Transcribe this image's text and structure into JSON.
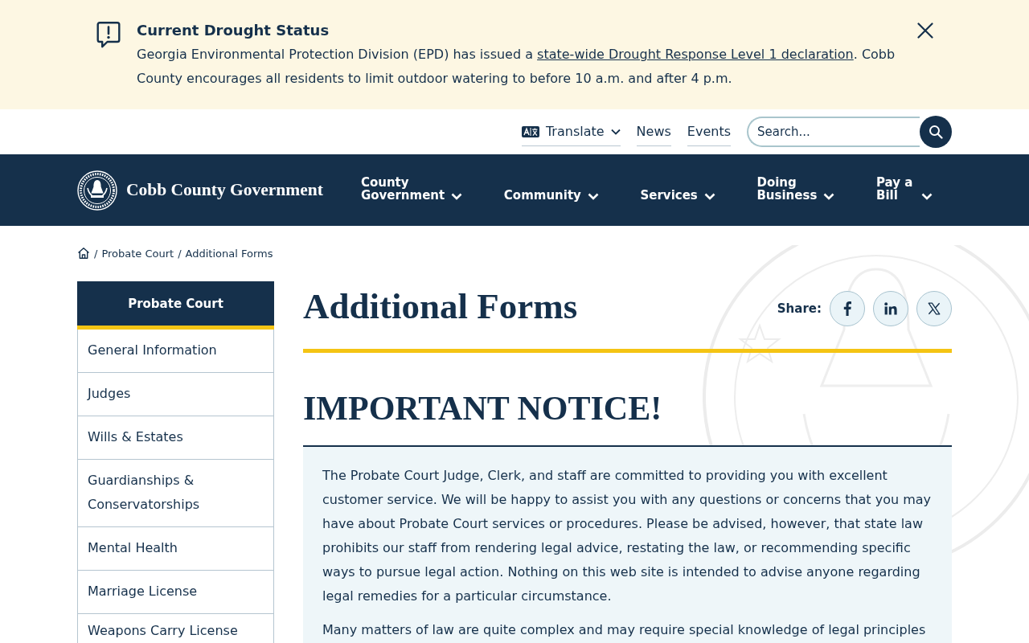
{
  "alert": {
    "title": "Current Drought Status",
    "text_before": "Georgia Environmental Protection Division (EPD) has issued a ",
    "link": "state-wide Drought Response Level 1 declaration",
    "text_after": ". Cobb County encourages all residents to limit outdoor watering to before 10 a.m. and after 4 p.m."
  },
  "utility_nav": {
    "links": [
      {
        "kind": "translate",
        "label": "Translate"
      },
      {
        "kind": "link",
        "label": "News"
      },
      {
        "kind": "link",
        "label": "Events"
      }
    ],
    "search": {
      "placeholder": "Search..."
    }
  },
  "header": {
    "site_name": "Cobb County Government",
    "nav": [
      {
        "label": "County Government"
      },
      {
        "label": "Community"
      },
      {
        "label": "Services"
      },
      {
        "label": "Doing Business"
      },
      {
        "label": "Pay a Bill"
      }
    ]
  },
  "breadcrumb": [
    {
      "kind": "home"
    },
    {
      "kind": "separator",
      "text": "/"
    },
    {
      "kind": "link",
      "label": "Probate Court"
    },
    {
      "kind": "separator",
      "text": "/"
    },
    {
      "kind": "current",
      "label": "Additional Forms"
    }
  ],
  "sidebar": {
    "title": "Probate Court",
    "items": [
      "General Information",
      "Judges",
      "Wills & Estates",
      "Guardianships & Conservatorships",
      "Mental Health",
      "Marriage License",
      "Weapons Carry License"
    ]
  },
  "page": {
    "title": "Additional Forms",
    "share_label": "Share:",
    "share": [
      {
        "kind": "facebook"
      },
      {
        "kind": "linkedin"
      },
      {
        "kind": "x"
      }
    ]
  },
  "notice": {
    "heading": "IMPORTANT NOTICE!",
    "paragraphs": [
      "The Probate Court Judge, Clerk, and staff are committed to providing you with excellent customer service. We will be happy to assist you with any questions or concerns that you may have about Probate Court services or procedures. Please be advised, however, that state law prohibits our staff from rendering legal advice, restating the law, or recommending specific ways to pursue legal action. Nothing on this web site is intended to advise anyone regarding legal remedies for a particular circumstance.",
      "Many matters of law are quite complex and may require special knowledge of legal principles"
    ]
  }
}
